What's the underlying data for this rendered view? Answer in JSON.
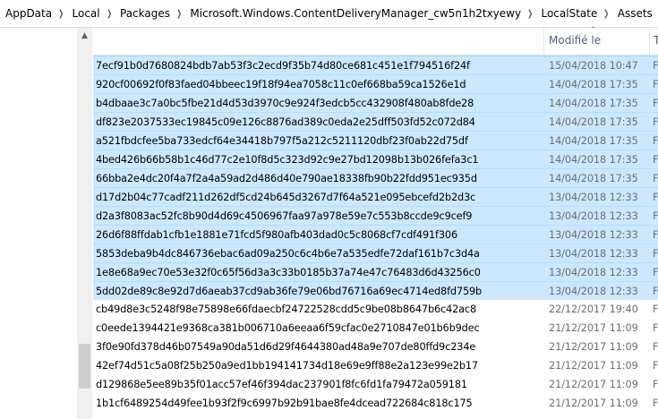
{
  "breadcrumb": [
    "AppData",
    "Local",
    "Packages",
    "Microsoft.Windows.ContentDeliveryManager_cw5n1h2txyewy",
    "LocalState",
    "Assets"
  ],
  "columns": {
    "date": "Modifié le",
    "type": "T"
  },
  "files": [
    {
      "name": "7ecf91b0d7680824bdb7ab53f3c2ecd9f35b74d80ce681c451e1f794516f24f",
      "date": "15/04/2018 10:47",
      "type": "F",
      "selected": true
    },
    {
      "name": "920cf00692f0f83faed04bbeec19f18f94ea7058c11c0ef668ba59ca1526e1d",
      "date": "14/04/2018 17:35",
      "type": "F",
      "selected": true
    },
    {
      "name": "b4dbaae3c7a0bc5fbe21d4d53d3970c9e924f3edcb5cc432908f480ab8fde28",
      "date": "14/04/2018 17:35",
      "type": "F",
      "selected": true
    },
    {
      "name": "df823e2037533ec19845c09e126c8876ad389c0eda2e25dff503fd52c072d84",
      "date": "14/04/2018 17:35",
      "type": "F",
      "selected": true
    },
    {
      "name": "a521fbdcfee5ba733edcf64e34418b797f5a212c5211120dbf23f0ab22d75df",
      "date": "14/04/2018 17:35",
      "type": "F",
      "selected": true
    },
    {
      "name": "4bed426b66b58b1c46d77c2e10f8d5c323d92c9e27bd12098b13b026fefa3c1",
      "date": "14/04/2018 17:35",
      "type": "F",
      "selected": true
    },
    {
      "name": "66bba2e4dc20f4a7f2a4a59ad2d486d40e790ae18338fb90b22fdd951ec935d",
      "date": "14/04/2018 17:35",
      "type": "F",
      "selected": true
    },
    {
      "name": "d17d2b04c77cadf211d262df5cd24b645d3267d7f64a521e095ebcefd2b2d3c",
      "date": "13/04/2018 12:33",
      "type": "F",
      "selected": true
    },
    {
      "name": "d2a3f8083ac52fc8b90d4d69c4506967faa97a978e59e7c553b8ccde9c9cef9",
      "date": "13/04/2018 12:33",
      "type": "F",
      "selected": true
    },
    {
      "name": "26d6f88ffdab1cfb1e1881e71fcd5f980afb403dad0c5c8068cf7cdf491f306",
      "date": "13/04/2018 12:33",
      "type": "F",
      "selected": true
    },
    {
      "name": "5853deba9b4dc846736ebac6ad09a250c6c4b6e7a535edfe72daf161b7c3d4a",
      "date": "13/04/2018 12:33",
      "type": "F",
      "selected": true
    },
    {
      "name": "1e8e68a9ec70e53e32f0c65f56d3a3c33b0185b37a74e47c76483d6d43256c0",
      "date": "13/04/2018 12:33",
      "type": "F",
      "selected": true
    },
    {
      "name": "5dd02de89c8e92d7d6aeab37cd9ab36fe79e06bd76716a69ec4714ed8fd759b",
      "date": "13/04/2018 12:33",
      "type": "F",
      "selected": true
    },
    {
      "name": "cb49d8e3c5248f98e75898e66fdaecbf24722528cdd5c9be08b8647b6c42ac8",
      "date": "22/12/2017 19:40",
      "type": "F",
      "selected": false
    },
    {
      "name": "c0eede1394421e9368ca381b006710a6eeaa6f59cfac0e2710847e01b6b9dec",
      "date": "21/12/2017 11:09",
      "type": "F",
      "selected": false
    },
    {
      "name": "3f0e90fd378d46b07549a90da51d6d29f4644380ad48a9e707de80ffd9c234e",
      "date": "21/12/2017 11:09",
      "type": "F",
      "selected": false
    },
    {
      "name": "42ef74d51c5a08f25b250a9ed1bb194141734d18e69e9ff88e2a123e99e2b17",
      "date": "21/12/2017 11:09",
      "type": "F",
      "selected": false
    },
    {
      "name": "d129868e5ee89b35f01acc57ef46f394dac237901f8fc6fd1fa79472a059181",
      "date": "21/12/2017 11:09",
      "type": "F",
      "selected": false
    },
    {
      "name": "1b1cf6489254d49fee1b93f2f9c6997b92b91bae8fe4dcead722684c818c175",
      "date": "21/12/2017 11:09",
      "type": "F",
      "selected": false
    }
  ]
}
